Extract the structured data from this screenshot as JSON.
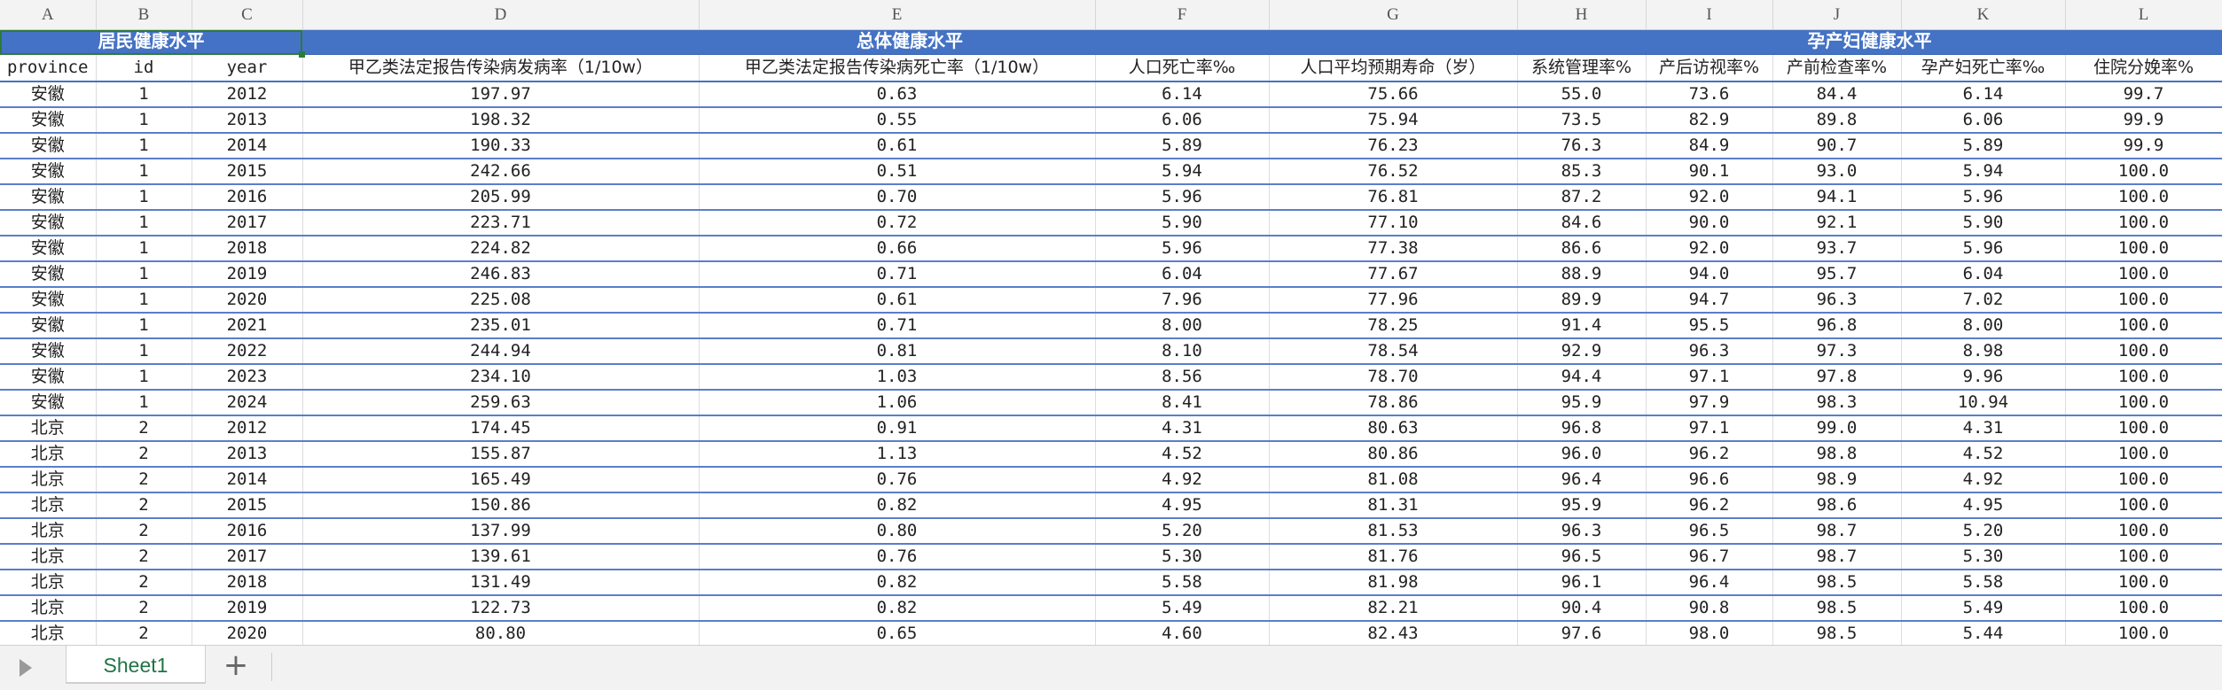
{
  "column_letters": [
    "A",
    "B",
    "C",
    "D",
    "E",
    "F",
    "G",
    "H",
    "I",
    "J",
    "K",
    "L"
  ],
  "group_headers": [
    "居民健康水平",
    "总体健康水平",
    "孕产妇健康水平"
  ],
  "field_headers": [
    "province",
    "id",
    "year",
    "甲乙类法定报告传染病发病率（1/10w）",
    "甲乙类法定报告传染病死亡率（1/10w）",
    "人口死亡率‰",
    "人口平均预期寿命（岁）",
    "系统管理率%",
    "产后访视率%",
    "产前检查率%",
    "孕产妇死亡率‰",
    "住院分娩率%"
  ],
  "rows": [
    [
      "安徽",
      "1",
      "2012",
      "197.97",
      "0.63",
      "6.14",
      "75.66",
      "55.0",
      "73.6",
      "84.4",
      "6.14",
      "99.7"
    ],
    [
      "安徽",
      "1",
      "2013",
      "198.32",
      "0.55",
      "6.06",
      "75.94",
      "73.5",
      "82.9",
      "89.8",
      "6.06",
      "99.9"
    ],
    [
      "安徽",
      "1",
      "2014",
      "190.33",
      "0.61",
      "5.89",
      "76.23",
      "76.3",
      "84.9",
      "90.7",
      "5.89",
      "99.9"
    ],
    [
      "安徽",
      "1",
      "2015",
      "242.66",
      "0.51",
      "5.94",
      "76.52",
      "85.3",
      "90.1",
      "93.0",
      "5.94",
      "100.0"
    ],
    [
      "安徽",
      "1",
      "2016",
      "205.99",
      "0.70",
      "5.96",
      "76.81",
      "87.2",
      "92.0",
      "94.1",
      "5.96",
      "100.0"
    ],
    [
      "安徽",
      "1",
      "2017",
      "223.71",
      "0.72",
      "5.90",
      "77.10",
      "84.6",
      "90.0",
      "92.1",
      "5.90",
      "100.0"
    ],
    [
      "安徽",
      "1",
      "2018",
      "224.82",
      "0.66",
      "5.96",
      "77.38",
      "86.6",
      "92.0",
      "93.7",
      "5.96",
      "100.0"
    ],
    [
      "安徽",
      "1",
      "2019",
      "246.83",
      "0.71",
      "6.04",
      "77.67",
      "88.9",
      "94.0",
      "95.7",
      "6.04",
      "100.0"
    ],
    [
      "安徽",
      "1",
      "2020",
      "225.08",
      "0.61",
      "7.96",
      "77.96",
      "89.9",
      "94.7",
      "96.3",
      "7.02",
      "100.0"
    ],
    [
      "安徽",
      "1",
      "2021",
      "235.01",
      "0.71",
      "8.00",
      "78.25",
      "91.4",
      "95.5",
      "96.8",
      "8.00",
      "100.0"
    ],
    [
      "安徽",
      "1",
      "2022",
      "244.94",
      "0.81",
      "8.10",
      "78.54",
      "92.9",
      "96.3",
      "97.3",
      "8.98",
      "100.0"
    ],
    [
      "安徽",
      "1",
      "2023",
      "234.10",
      "1.03",
      "8.56",
      "78.70",
      "94.4",
      "97.1",
      "97.8",
      "9.96",
      "100.0"
    ],
    [
      "安徽",
      "1",
      "2024",
      "259.63",
      "1.06",
      "8.41",
      "78.86",
      "95.9",
      "97.9",
      "98.3",
      "10.94",
      "100.0"
    ],
    [
      "北京",
      "2",
      "2012",
      "174.45",
      "0.91",
      "4.31",
      "80.63",
      "96.8",
      "97.1",
      "99.0",
      "4.31",
      "100.0"
    ],
    [
      "北京",
      "2",
      "2013",
      "155.87",
      "1.13",
      "4.52",
      "80.86",
      "96.0",
      "96.2",
      "98.8",
      "4.52",
      "100.0"
    ],
    [
      "北京",
      "2",
      "2014",
      "165.49",
      "0.76",
      "4.92",
      "81.08",
      "96.4",
      "96.6",
      "98.9",
      "4.92",
      "100.0"
    ],
    [
      "北京",
      "2",
      "2015",
      "150.86",
      "0.82",
      "4.95",
      "81.31",
      "95.9",
      "96.2",
      "98.6",
      "4.95",
      "100.0"
    ],
    [
      "北京",
      "2",
      "2016",
      "137.99",
      "0.80",
      "5.20",
      "81.53",
      "96.3",
      "96.5",
      "98.7",
      "5.20",
      "100.0"
    ],
    [
      "北京",
      "2",
      "2017",
      "139.61",
      "0.76",
      "5.30",
      "81.76",
      "96.5",
      "96.7",
      "98.7",
      "5.30",
      "100.0"
    ],
    [
      "北京",
      "2",
      "2018",
      "131.49",
      "0.82",
      "5.58",
      "81.98",
      "96.1",
      "96.4",
      "98.5",
      "5.58",
      "100.0"
    ],
    [
      "北京",
      "2",
      "2019",
      "122.73",
      "0.82",
      "5.49",
      "82.21",
      "90.4",
      "90.8",
      "98.5",
      "5.49",
      "100.0"
    ],
    [
      "北京",
      "2",
      "2020",
      "80.80",
      "0.65",
      "4.60",
      "82.43",
      "97.6",
      "98.0",
      "98.5",
      "5.44",
      "100.0"
    ]
  ],
  "sheet_tabs": [
    "Sheet1"
  ],
  "add_sheet_label": "+",
  "colors": {
    "header_fill": "#4472c4",
    "row_border": "#5b7ec9",
    "tab_text": "#217346",
    "selection": "#2d7a3b"
  },
  "icons": {
    "nav": "play-triangle-icon",
    "add": "plus-icon"
  }
}
